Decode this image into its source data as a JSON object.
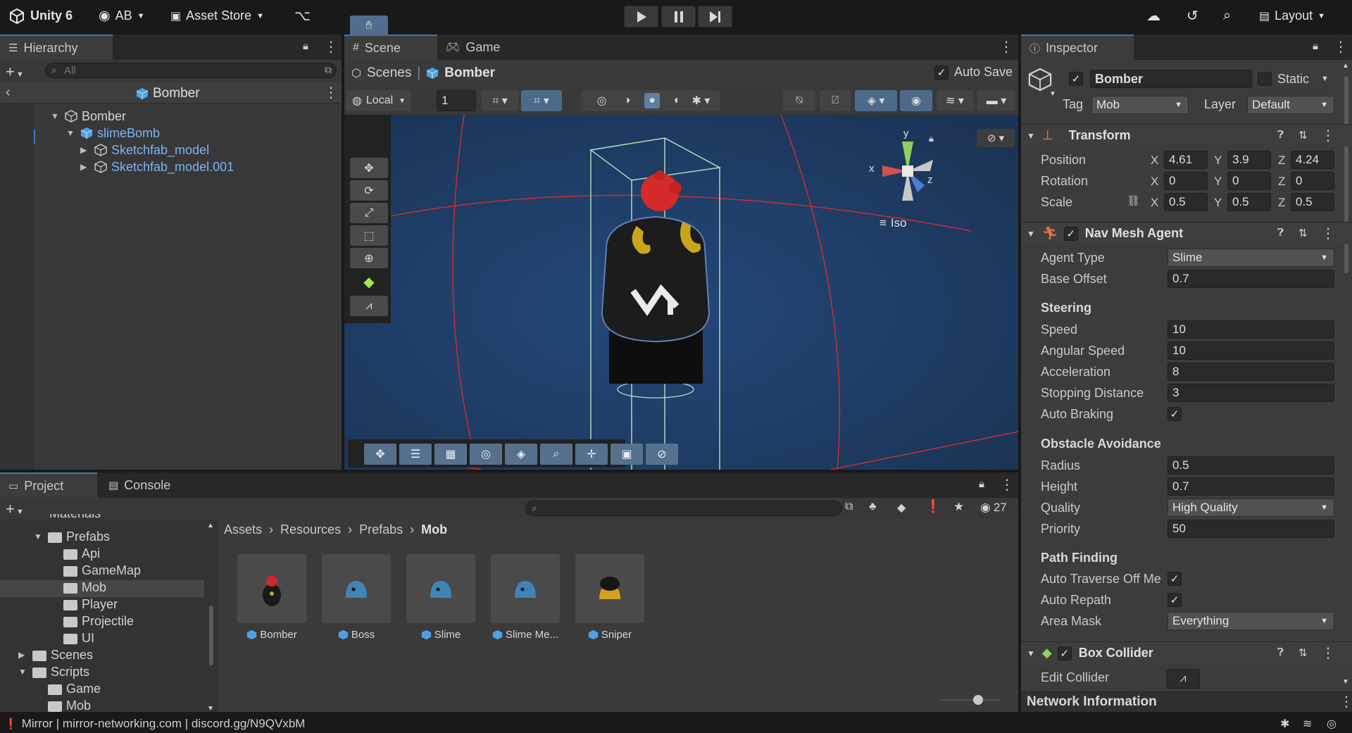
{
  "topbar": {
    "app_title": "Unity 6",
    "account": "AB",
    "asset_store": "Asset Store",
    "layout": "Layout"
  },
  "hierarchy": {
    "tab": "Hierarchy",
    "search_placeholder": "All",
    "scene_root": "Bomber",
    "items": [
      {
        "label": "Bomber"
      },
      {
        "label": "slimeBomb"
      },
      {
        "label": "Sketchfab_model"
      },
      {
        "label": "Sketchfab_model.001"
      }
    ]
  },
  "scene": {
    "tab_scene": "Scene",
    "tab_game": "Game",
    "breadcrumb_root": "Scenes",
    "breadcrumb_current": "Bomber",
    "auto_save": "Auto Save",
    "pivot_mode": "Local",
    "grid_value": "1",
    "projection": "Iso",
    "gizmo_axes": {
      "x": "x",
      "y": "y",
      "z": "z"
    }
  },
  "project": {
    "tab_project": "Project",
    "tab_console": "Console",
    "visible_count": "27",
    "breadcrumb": [
      "Assets",
      "Resources",
      "Prefabs",
      "Mob"
    ],
    "tree": [
      {
        "label": "Materials"
      },
      {
        "label": "Prefabs"
      },
      {
        "label": "Api"
      },
      {
        "label": "GameMap"
      },
      {
        "label": "Mob"
      },
      {
        "label": "Player"
      },
      {
        "label": "Projectile"
      },
      {
        "label": "UI"
      },
      {
        "label": "Scenes"
      },
      {
        "label": "Scripts"
      },
      {
        "label": "Game"
      },
      {
        "label": "Mob"
      }
    ],
    "assets": [
      {
        "label": "Bomber"
      },
      {
        "label": "Boss"
      },
      {
        "label": "Slime"
      },
      {
        "label": "Slime Me..."
      },
      {
        "label": "Sniper"
      }
    ]
  },
  "inspector": {
    "tab": "Inspector",
    "object_name": "Bomber",
    "static_label": "Static",
    "tag_label": "Tag",
    "tag_value": "Mob",
    "layer_label": "Layer",
    "layer_value": "Default",
    "transform": {
      "title": "Transform",
      "position_label": "Position",
      "rotation_label": "Rotation",
      "scale_label": "Scale",
      "position": {
        "x": "4.61",
        "y": "3.9",
        "z": "4.24"
      },
      "rotation": {
        "x": "0",
        "y": "0",
        "z": "0"
      },
      "scale": {
        "x": "0.5",
        "y": "0.5",
        "z": "0.5"
      },
      "axis_x": "X",
      "axis_y": "Y",
      "axis_z": "Z"
    },
    "nav_mesh_agent": {
      "title": "Nav Mesh Agent",
      "agent_type_label": "Agent Type",
      "agent_type": "Slime",
      "base_offset_label": "Base Offset",
      "base_offset": "0.7",
      "steering_heading": "Steering",
      "speed_label": "Speed",
      "speed": "10",
      "angular_speed_label": "Angular Speed",
      "angular_speed": "10",
      "acceleration_label": "Acceleration",
      "acceleration": "8",
      "stopping_distance_label": "Stopping Distance",
      "stopping_distance": "3",
      "auto_braking_label": "Auto Braking",
      "obstacle_heading": "Obstacle Avoidance",
      "radius_label": "Radius",
      "radius": "0.5",
      "height_label": "Height",
      "height": "0.7",
      "quality_label": "Quality",
      "quality": "High Quality",
      "priority_label": "Priority",
      "priority": "50",
      "path_heading": "Path Finding",
      "auto_traverse_label": "Auto Traverse Off Me",
      "auto_repath_label": "Auto Repath",
      "area_mask_label": "Area Mask",
      "area_mask": "Everything"
    },
    "box_collider": {
      "title": "Box Collider",
      "edit_collider_label": "Edit Collider"
    },
    "network_info": "Network Information"
  },
  "statusbar": {
    "text": "Mirror | mirror-networking.com | discord.gg/N9QVxbM"
  },
  "colors": {
    "accent_blue": "#3a79bb",
    "prefab_blue": "#7db2f3",
    "scene_bg": "#1f3a5c",
    "selection_line": "#c8302e"
  }
}
